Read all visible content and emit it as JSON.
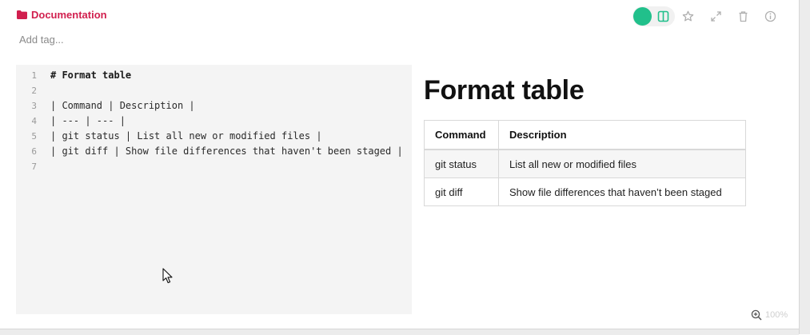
{
  "header": {
    "folder_label": "Documentation",
    "tag_placeholder": "Add tag..."
  },
  "toolbar": {
    "icons": [
      "status-dot",
      "split-view-icon",
      "star-icon",
      "fullscreen-icon",
      "trash-icon",
      "info-icon"
    ]
  },
  "editor": {
    "lines": [
      {
        "num": "1",
        "text": "# Format table"
      },
      {
        "num": "2",
        "text": ""
      },
      {
        "num": "3",
        "text": "| Command | Description |"
      },
      {
        "num": "4",
        "text": "| --- | --- |"
      },
      {
        "num": "5",
        "text": "| git status | List all new or modified files |"
      },
      {
        "num": "6",
        "text": "| git diff | Show file differences that haven't been staged |"
      },
      {
        "num": "7",
        "text": ""
      }
    ]
  },
  "preview": {
    "title": "Format table",
    "headers": [
      "Command",
      "Description"
    ],
    "rows": [
      [
        "git status",
        "List all new or modified files"
      ],
      [
        "git diff",
        "Show file differences that haven’t been staged"
      ]
    ]
  },
  "zoom": {
    "label": "100%"
  },
  "colors": {
    "accent": "#d11f4e",
    "status": "#21c08b",
    "editor_bg": "#f4f4f4"
  }
}
